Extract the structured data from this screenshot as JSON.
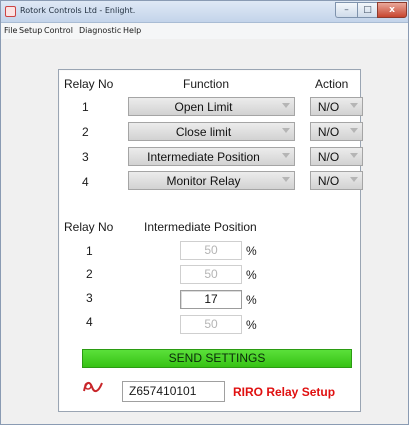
{
  "window": {
    "title": "Rotork Controls Ltd - Enlight.",
    "buttons": {
      "minimize": "–",
      "maximize": "□",
      "close": "x"
    }
  },
  "menu": [
    "File",
    "Setup",
    "Control",
    "Diagnostic",
    "Help"
  ],
  "relay_table": {
    "headers": {
      "relay_no": "Relay No",
      "function": "Function",
      "action": "Action"
    },
    "rows": [
      {
        "no": "1",
        "function": "Open Limit",
        "action": "N/O"
      },
      {
        "no": "2",
        "function": "Close limit",
        "action": "N/O"
      },
      {
        "no": "3",
        "function": "Intermediate Position",
        "action": "N/O"
      },
      {
        "no": "4",
        "function": "Monitor Relay",
        "action": "N/O"
      }
    ]
  },
  "intermediate_table": {
    "headers": {
      "relay_no": "Relay No",
      "position": "Intermediate Position"
    },
    "unit": "%",
    "rows": [
      {
        "no": "1",
        "value": "50",
        "active": false
      },
      {
        "no": "2",
        "value": "50",
        "active": false
      },
      {
        "no": "3",
        "value": "17",
        "active": true
      },
      {
        "no": "4",
        "value": "50",
        "active": false
      }
    ]
  },
  "send_button": "SEND SETTINGS",
  "serial_number": "Z657410101",
  "setup_label": "RIRO Relay Setup",
  "colors": {
    "accent_green": "#37c214",
    "setup_label_red": "#e01010",
    "logo_red": "#c8262a"
  },
  "icons": {
    "logo": "rotork-logo-icon",
    "dropdown": "dropdown-arrow-icon"
  }
}
